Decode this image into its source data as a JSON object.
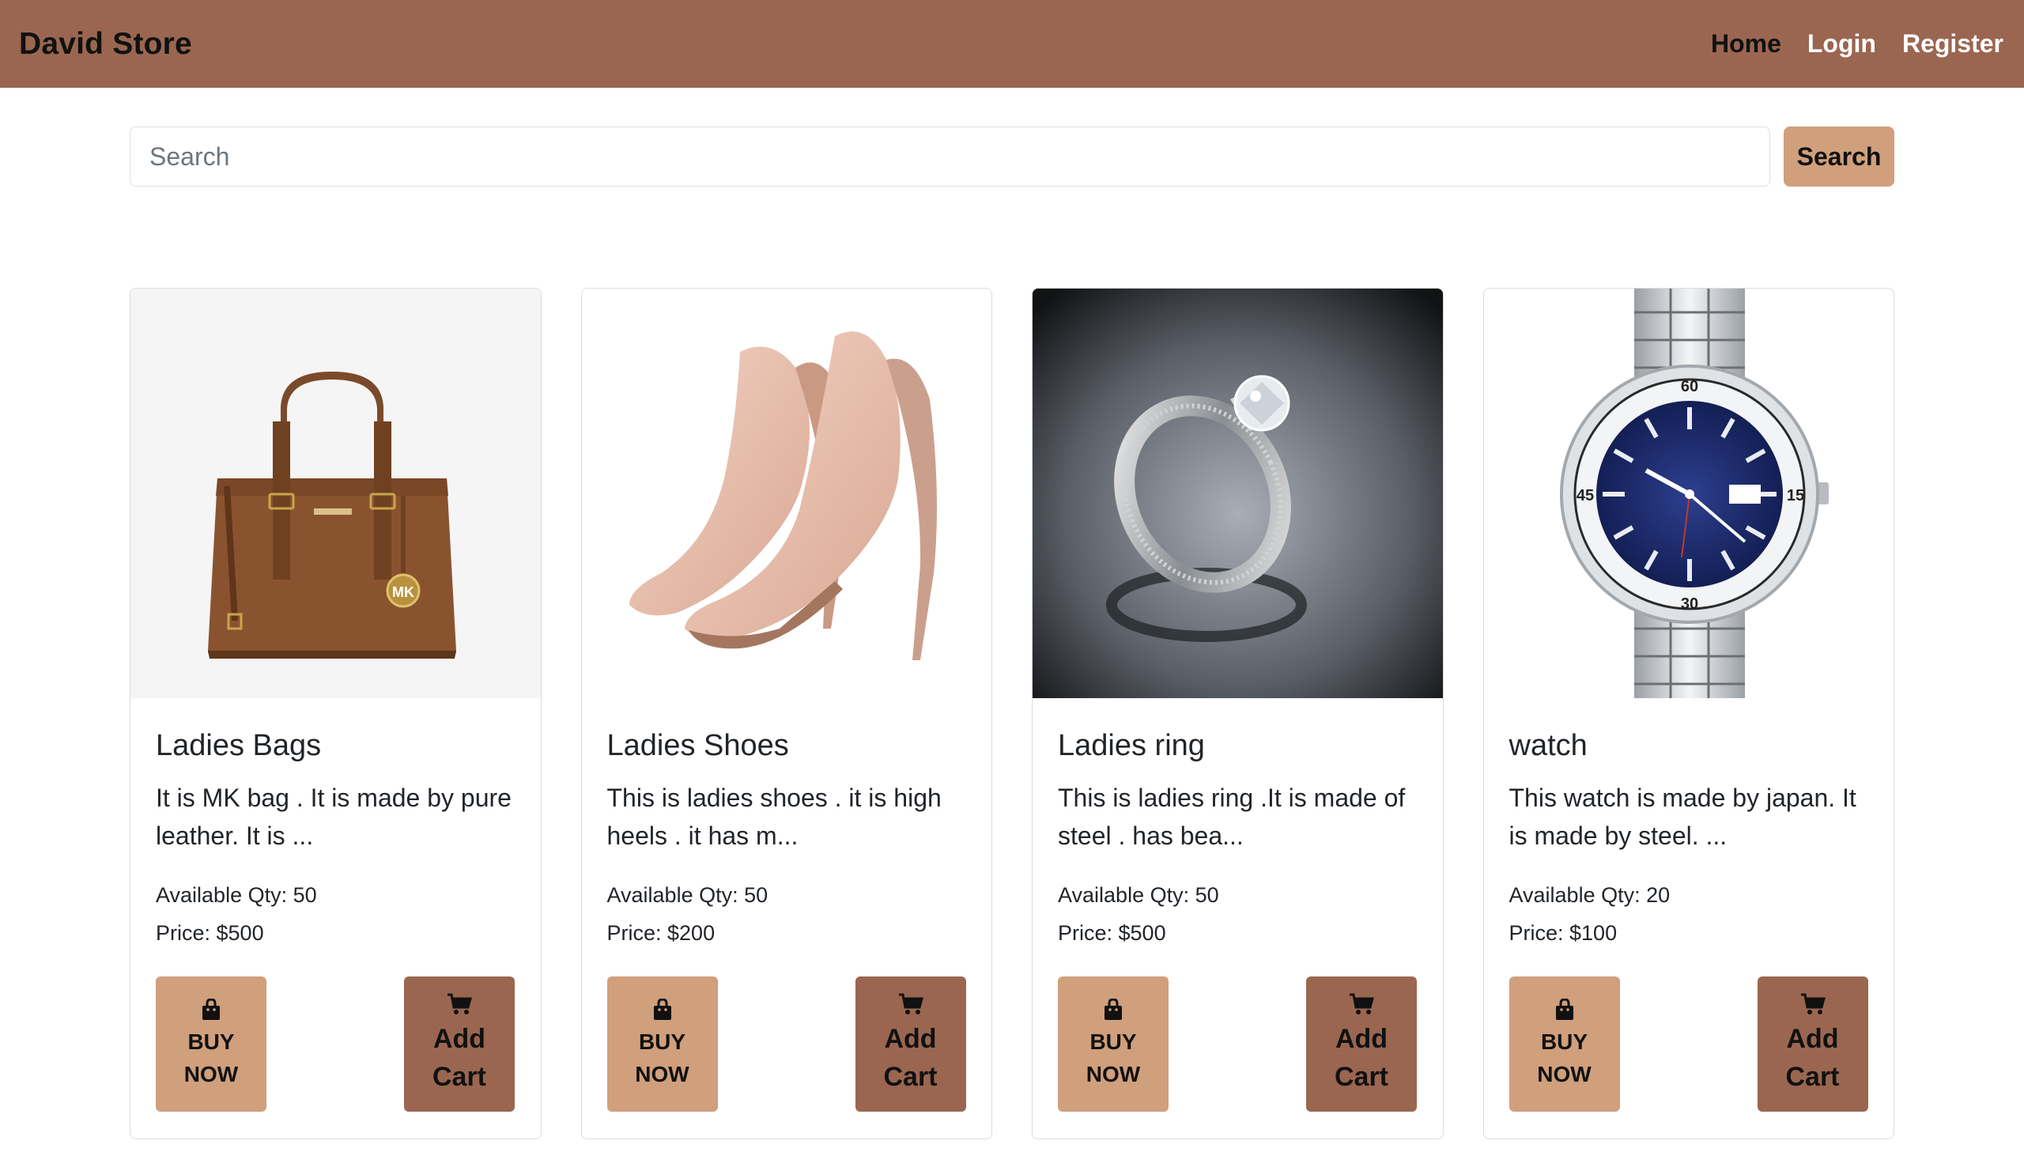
{
  "navbar": {
    "brand": "David Store",
    "links": [
      {
        "label": "Home",
        "active": true
      },
      {
        "label": "Login",
        "active": false
      },
      {
        "label": "Register",
        "active": false
      }
    ]
  },
  "search": {
    "placeholder": "Search",
    "value": "",
    "button_label": "Search"
  },
  "colors": {
    "navbar_bg": "#9a6650",
    "accent_light": "#d09f7c",
    "accent_dark": "#9a6650"
  },
  "products": [
    {
      "image_icon": "handbag-image",
      "title": "Ladies Bags",
      "description": "It is MK bag . It is made by pure leather. It is ...",
      "qty": "Available Qty: 50",
      "price": "Price: $500",
      "buy_label_1": "BUY",
      "buy_label_2": "NOW",
      "cart_label_1": "Add",
      "cart_label_2": "Cart"
    },
    {
      "image_icon": "high-heels-image",
      "title": "Ladies Shoes",
      "description": "This is ladies shoes . it is high heels . it has m...",
      "qty": "Available Qty: 50",
      "price": "Price: $200",
      "buy_label_1": "BUY",
      "buy_label_2": "NOW",
      "cart_label_1": "Add",
      "cart_label_2": "Cart"
    },
    {
      "image_icon": "ring-image",
      "title": "Ladies ring",
      "description": "This is ladies ring .It is made of steel . has bea...",
      "qty": "Available Qty: 50",
      "price": "Price: $500",
      "buy_label_1": "BUY",
      "buy_label_2": "NOW",
      "cart_label_1": "Add",
      "cart_label_2": "Cart"
    },
    {
      "image_icon": "watch-image",
      "title": "watch",
      "description": "This watch is made by japan. It is made by steel. ...",
      "qty": "Available Qty: 20",
      "price": "Price: $100",
      "buy_label_1": "BUY",
      "buy_label_2": "NOW",
      "cart_label_1": "Add",
      "cart_label_2": "Cart"
    }
  ]
}
